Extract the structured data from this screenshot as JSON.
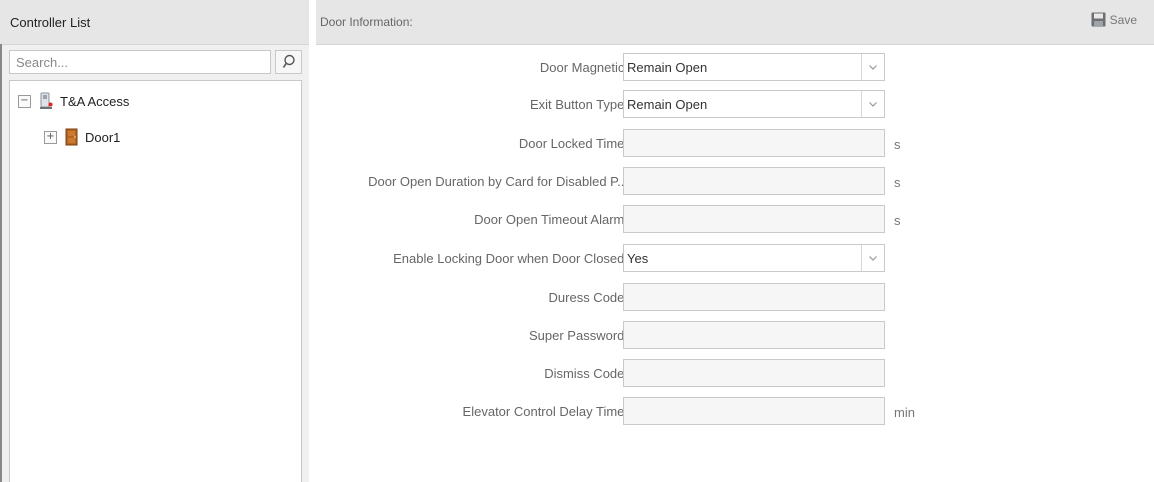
{
  "left_panel": {
    "title": "Controller List",
    "search": {
      "placeholder": "Search..."
    },
    "tree": [
      {
        "label": "T&A Access",
        "toggle": "−",
        "icon": "controller-icon"
      },
      {
        "label": "Door1",
        "toggle": "+",
        "icon": "door-icon"
      }
    ]
  },
  "right_panel": {
    "title": "Door Information:",
    "save_label": "Save",
    "fields": [
      {
        "label": "Door Magnetic:",
        "type": "select",
        "value": "Remain Open",
        "unit": ""
      },
      {
        "label": "Exit Button Type:",
        "type": "select",
        "value": "Remain Open",
        "unit": ""
      },
      {
        "label": "Door Locked Time:",
        "type": "text",
        "value": "",
        "unit": "s"
      },
      {
        "label": "Door Open Duration by Card for Disabled P...",
        "type": "text",
        "value": "",
        "unit": "s"
      },
      {
        "label": "Door Open Timeout Alarm:",
        "type": "text",
        "value": "",
        "unit": "s"
      },
      {
        "label": "Enable Locking Door when Door Closed:",
        "type": "select",
        "value": "Yes",
        "unit": ""
      },
      {
        "label": "Duress Code:",
        "type": "text",
        "value": "",
        "unit": ""
      },
      {
        "label": "Super Password:",
        "type": "text",
        "value": "",
        "unit": ""
      },
      {
        "label": "Dismiss Code:",
        "type": "text",
        "value": "",
        "unit": ""
      },
      {
        "label": "Elevator Control Delay Time:",
        "type": "text",
        "value": "",
        "unit": "min"
      }
    ]
  },
  "colors": {
    "header_bg": "#e6e6e6",
    "panel_bg": "#f0f0f0",
    "door_icon": "#b5651d",
    "save_icon": "#6b6f73"
  }
}
